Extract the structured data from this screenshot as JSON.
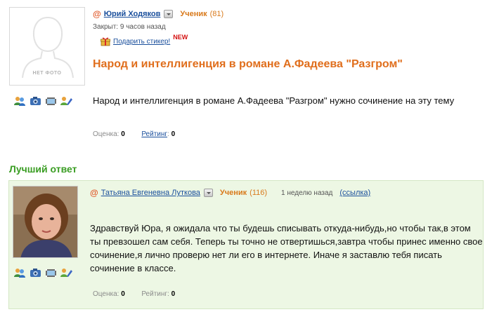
{
  "question": {
    "avatar_placeholder": "НЕТ ФОТО",
    "author": "Юрий Ходяков",
    "rank": "Ученик",
    "rank_count": "(81)",
    "closed": "Закрыт: 9 часов назад",
    "gift_sticker": "Подарить стикер!",
    "new_badge": "NEW",
    "title": "Народ и интеллигенция в романе А.Фадеева \"Разгром\"",
    "body": "Народ и интеллигенция в романе А.Фадеева \"Разгром\" нужно сочинение на эту тему",
    "score_label": "Оценка:",
    "score_value": "0",
    "rating_label": "Рейтинг",
    "rating_value": "0"
  },
  "best_answer": {
    "section_title": "Лучший ответ",
    "author": "Татьяна Евгеневна Луткова",
    "rank": "Ученик",
    "rank_count": "(116)",
    "time": "1 неделю назад",
    "link": "(ссылка)",
    "body": "Здравствуй Юра, я ожидала что ты будешь списывать откуда-нибудь,но чтобы так,в этом ты превзошел сам себя. Теперь ты точно не отвертишься,завтра чтобы принес именно свое сочинение,я лично проверю нет ли его в интернете. Иначе я заставлю тебя писать сочинение в классе.",
    "score_label": "Оценка:",
    "score_value": "0",
    "rating_label": "Рейтинг:",
    "rating_value": "0"
  },
  "icons": [
    "friends-icon",
    "camera-icon",
    "video-icon",
    "edit-icon"
  ],
  "colors": {
    "link": "#1a4f9c",
    "title_orange": "#e06e1c",
    "rank_orange": "#d97a1c",
    "best_green": "#3a9d23",
    "answer_bg": "#edf7e4",
    "new_red": "#d41111"
  }
}
